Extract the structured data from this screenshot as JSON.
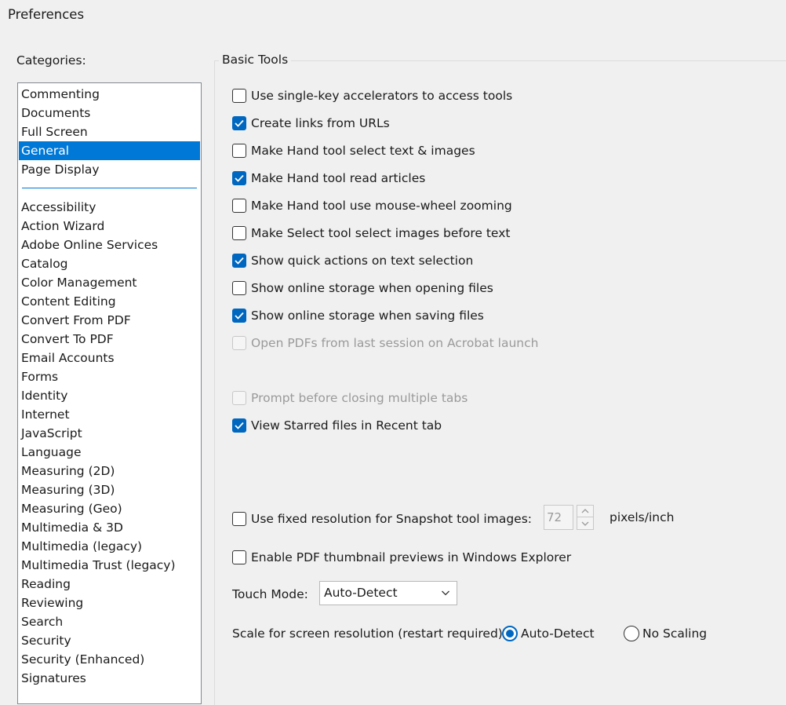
{
  "window": {
    "title": "Preferences"
  },
  "categories": {
    "label": "Categories:",
    "top_items": [
      "Commenting",
      "Documents",
      "Full Screen",
      "General",
      "Page Display"
    ],
    "selected": "General",
    "items": [
      "Accessibility",
      "Action Wizard",
      "Adobe Online Services",
      "Catalog",
      "Color Management",
      "Content Editing",
      "Convert From PDF",
      "Convert To PDF",
      "Email Accounts",
      "Forms",
      "Identity",
      "Internet",
      "JavaScript",
      "Language",
      "Measuring (2D)",
      "Measuring (3D)",
      "Measuring (Geo)",
      "Multimedia & 3D",
      "Multimedia (legacy)",
      "Multimedia Trust (legacy)",
      "Reading",
      "Reviewing",
      "Search",
      "Security",
      "Security (Enhanced)",
      "Signatures"
    ]
  },
  "basic_tools": {
    "title": "Basic Tools",
    "options": [
      {
        "label": "Use single-key accelerators to access tools",
        "checked": false,
        "enabled": true
      },
      {
        "label": "Create links from URLs",
        "checked": true,
        "enabled": true
      },
      {
        "label": "Make Hand tool select text & images",
        "checked": false,
        "enabled": true
      },
      {
        "label": "Make Hand tool read articles",
        "checked": true,
        "enabled": true
      },
      {
        "label": "Make Hand tool use mouse-wheel zooming",
        "checked": false,
        "enabled": true
      },
      {
        "label": "Make Select tool select images before text",
        "checked": false,
        "enabled": true
      },
      {
        "label": "Show quick actions on text selection",
        "checked": true,
        "enabled": true
      },
      {
        "label": "Show online storage when opening files",
        "checked": false,
        "enabled": true
      },
      {
        "label": "Show online storage when saving files",
        "checked": true,
        "enabled": true
      },
      {
        "label": "Open PDFs from last session on Acrobat launch",
        "checked": false,
        "enabled": false
      },
      {
        "label": "Prompt before closing multiple tabs",
        "checked": false,
        "enabled": false
      },
      {
        "label": "View Starred files in Recent tab",
        "checked": true,
        "enabled": true
      },
      {
        "label": "Use fixed resolution for Snapshot tool images:",
        "checked": false,
        "enabled": true
      },
      {
        "label": "Enable PDF thumbnail previews in Windows Explorer",
        "checked": false,
        "enabled": true
      }
    ],
    "snapshot_resolution": {
      "value": "72",
      "unit": "pixels/inch"
    },
    "touch_mode": {
      "label": "Touch Mode:",
      "value": "Auto-Detect"
    },
    "scale": {
      "label": "Scale for screen resolution (restart required):",
      "options": [
        {
          "label": "Auto-Detect",
          "selected": true
        },
        {
          "label": "No Scaling",
          "selected": false
        }
      ]
    }
  },
  "colors": {
    "accent": "#0078d7",
    "checkbox": "#0067c0"
  }
}
